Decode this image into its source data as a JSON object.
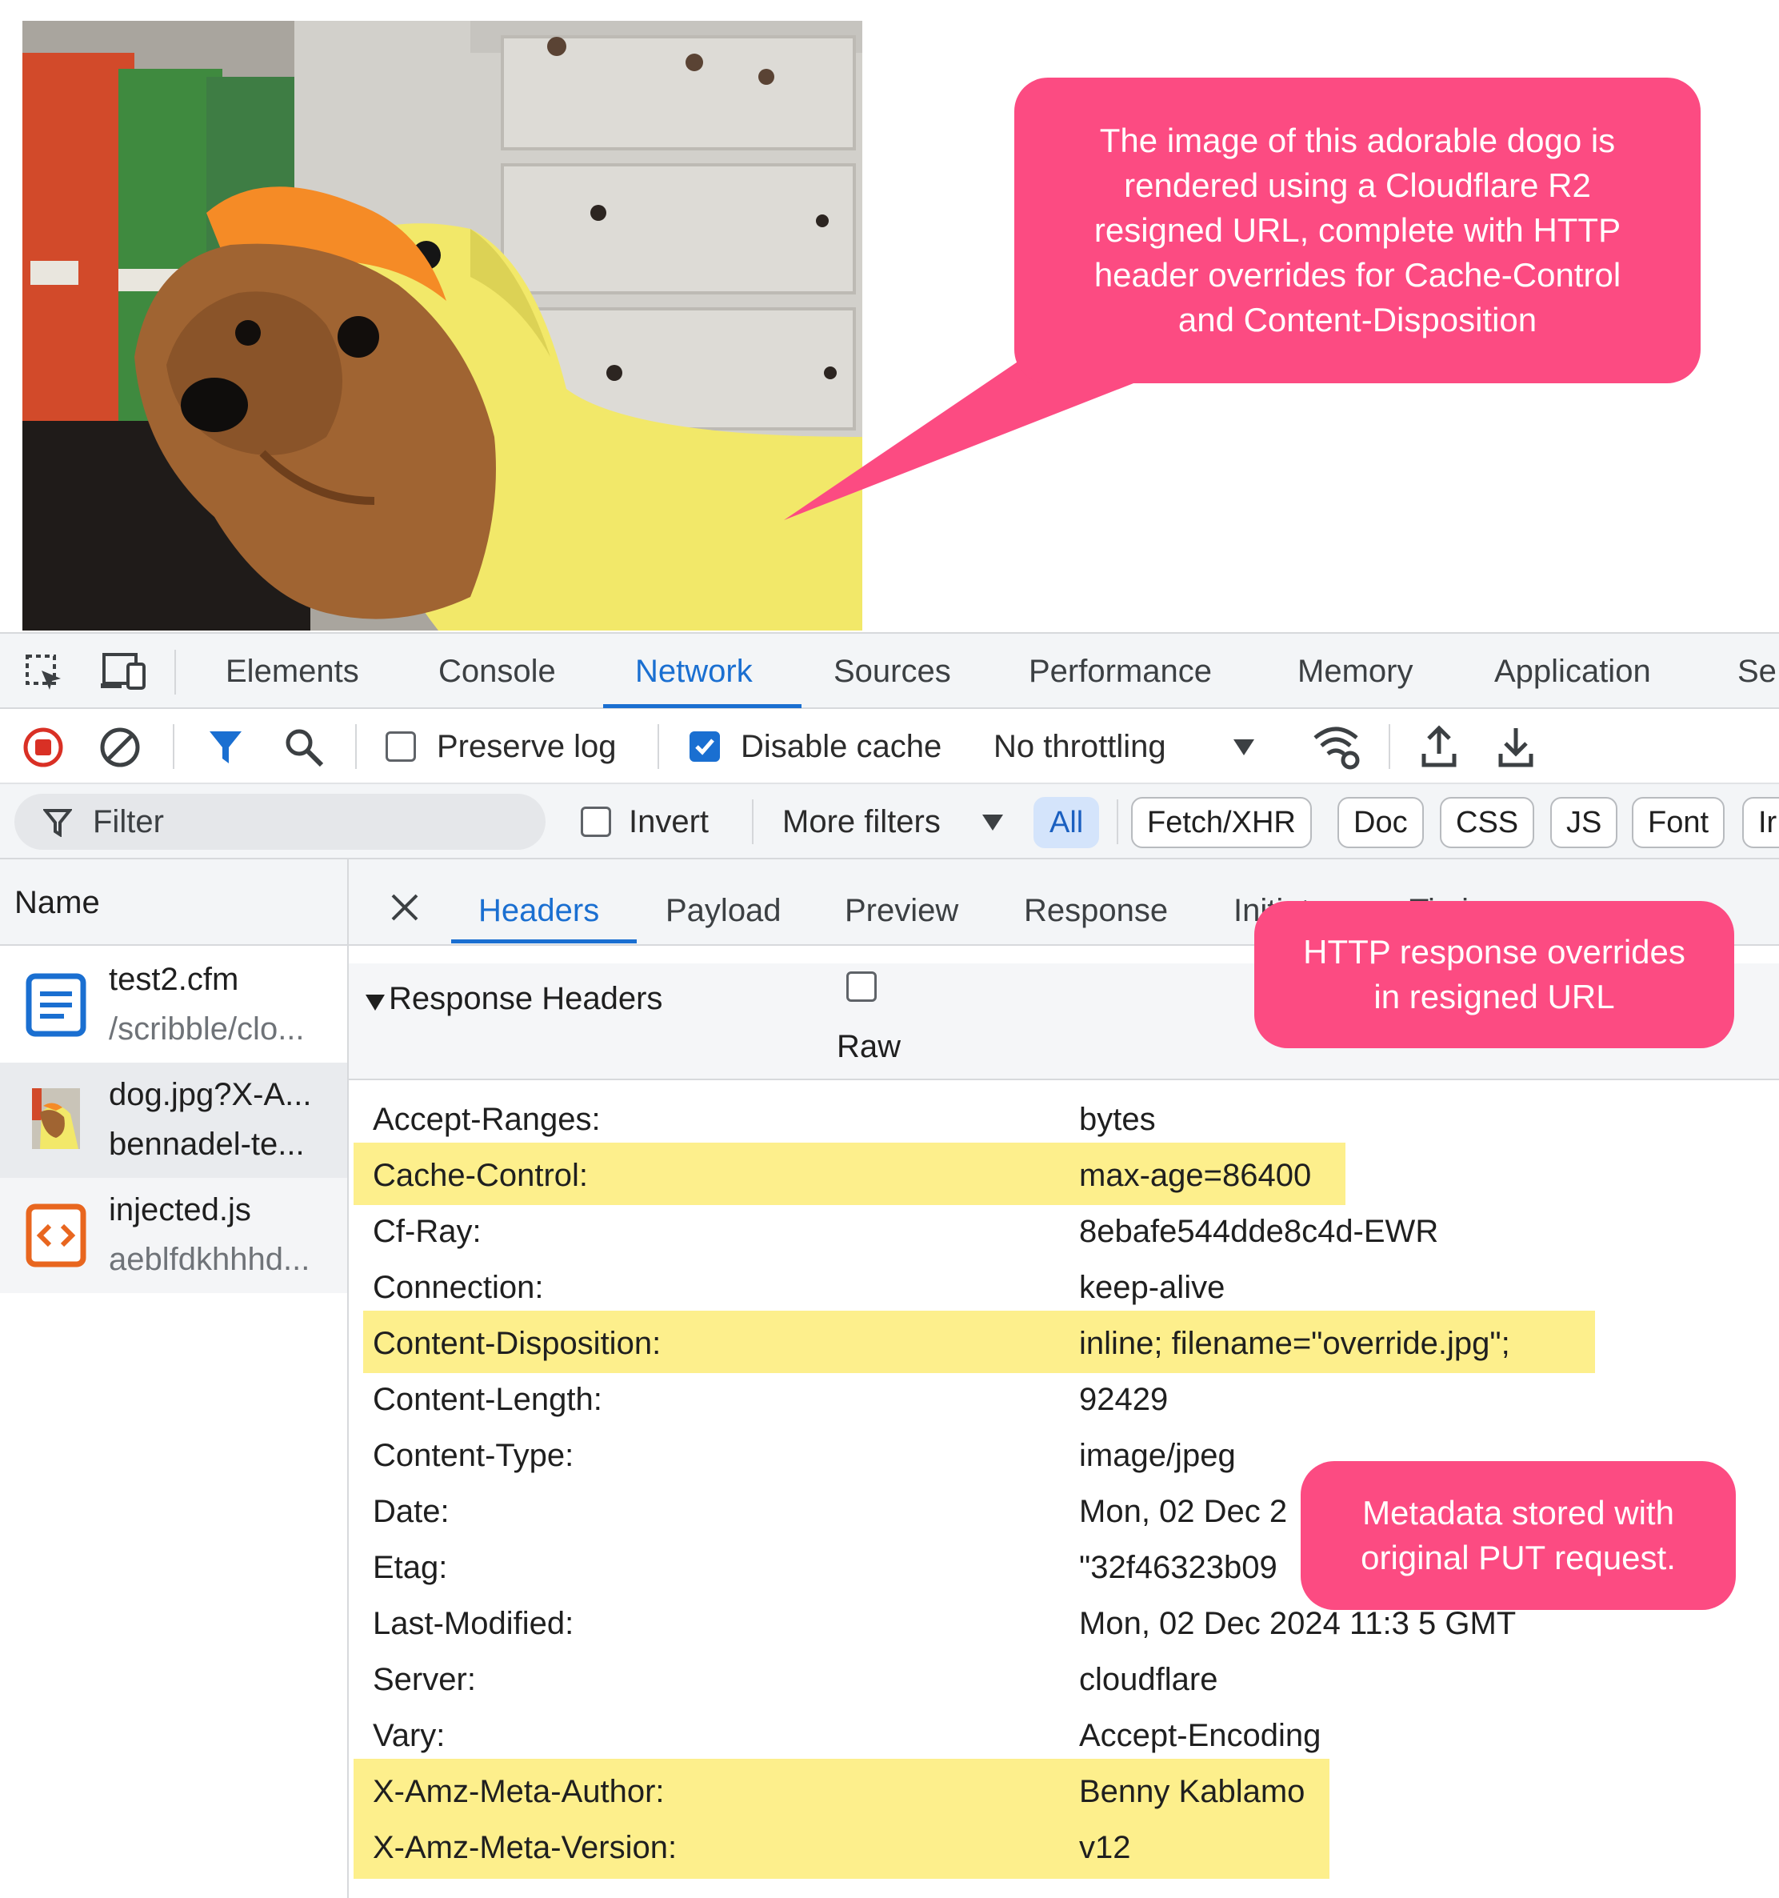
{
  "callouts": {
    "image_note": [
      "The image of this adorable dogo is",
      "rendered using a Cloudflare R2",
      "resigned URL, complete with HTTP",
      "header overrides for Cache-Control",
      "and Content-Disposition"
    ],
    "override_note": [
      "HTTP response overrides",
      "in resigned URL"
    ],
    "metadata_note": [
      "Metadata stored with",
      "original PUT request."
    ],
    "color": "#fc4b82"
  },
  "devtools": {
    "tabs": [
      "Elements",
      "Console",
      "Network",
      "Sources",
      "Performance",
      "Memory",
      "Application",
      "Se"
    ],
    "active_tab": "Network",
    "toolbar": {
      "preserve_log_label": "Preserve log",
      "preserve_log_checked": false,
      "disable_cache_label": "Disable cache",
      "disable_cache_checked": true,
      "throttling": "No throttling"
    },
    "filter": {
      "placeholder": "Filter",
      "invert_label": "Invert",
      "more_filters_label": "More filters",
      "chips": [
        "All",
        "Fetch/XHR",
        "Doc",
        "CSS",
        "JS",
        "Font",
        "Ir"
      ],
      "active_chip": "All"
    },
    "requests": {
      "column_header": "Name",
      "items": [
        {
          "name": "test2.cfm",
          "sub": "/scribble/clo...",
          "icon": "document-icon"
        },
        {
          "name": "dog.jpg?X-A...",
          "sub": "bennadel-te...",
          "icon": "image-thumbnail-icon"
        },
        {
          "name": "injected.js",
          "sub": "aeblfdkhhhd...",
          "icon": "script-icon"
        }
      ]
    },
    "detail": {
      "tabs": [
        "Headers",
        "Payload",
        "Preview",
        "Response",
        "Initiator",
        "Timing"
      ],
      "active_tab": "Headers",
      "section_title": "Response Headers",
      "raw_label": "Raw",
      "headers": [
        {
          "name": "Accept-Ranges:",
          "value": "bytes",
          "highlight": false
        },
        {
          "name": "Cache-Control:",
          "value": "max-age=86400",
          "highlight": true
        },
        {
          "name": "Cf-Ray:",
          "value": "8ebafe544dde8c4d-EWR",
          "highlight": false
        },
        {
          "name": "Connection:",
          "value": "keep-alive",
          "highlight": false
        },
        {
          "name": "Content-Disposition:",
          "value": "inline; filename=\"override.jpg\";",
          "highlight": true
        },
        {
          "name": "Content-Length:",
          "value": "92429",
          "highlight": false
        },
        {
          "name": "Content-Type:",
          "value": "image/jpeg",
          "highlight": false
        },
        {
          "name": "Date:",
          "value": "Mon, 02 Dec 2",
          "highlight": false
        },
        {
          "name": "Etag:",
          "value": "\"32f46323b09",
          "highlight": false
        },
        {
          "name": "Last-Modified:",
          "value": "Mon, 02 Dec 2024 11:3 5 GMT",
          "highlight": false
        },
        {
          "name": "Server:",
          "value": "cloudflare",
          "highlight": false
        },
        {
          "name": "Vary:",
          "value": "Accept-Encoding",
          "highlight": false
        },
        {
          "name": "X-Amz-Meta-Author:",
          "value": "Benny Kablamo",
          "highlight": true
        },
        {
          "name": "X-Amz-Meta-Version:",
          "value": "v12",
          "highlight": true
        }
      ]
    },
    "accent_color": "#1a6fd1",
    "highlight_color": "#fdef8c"
  }
}
